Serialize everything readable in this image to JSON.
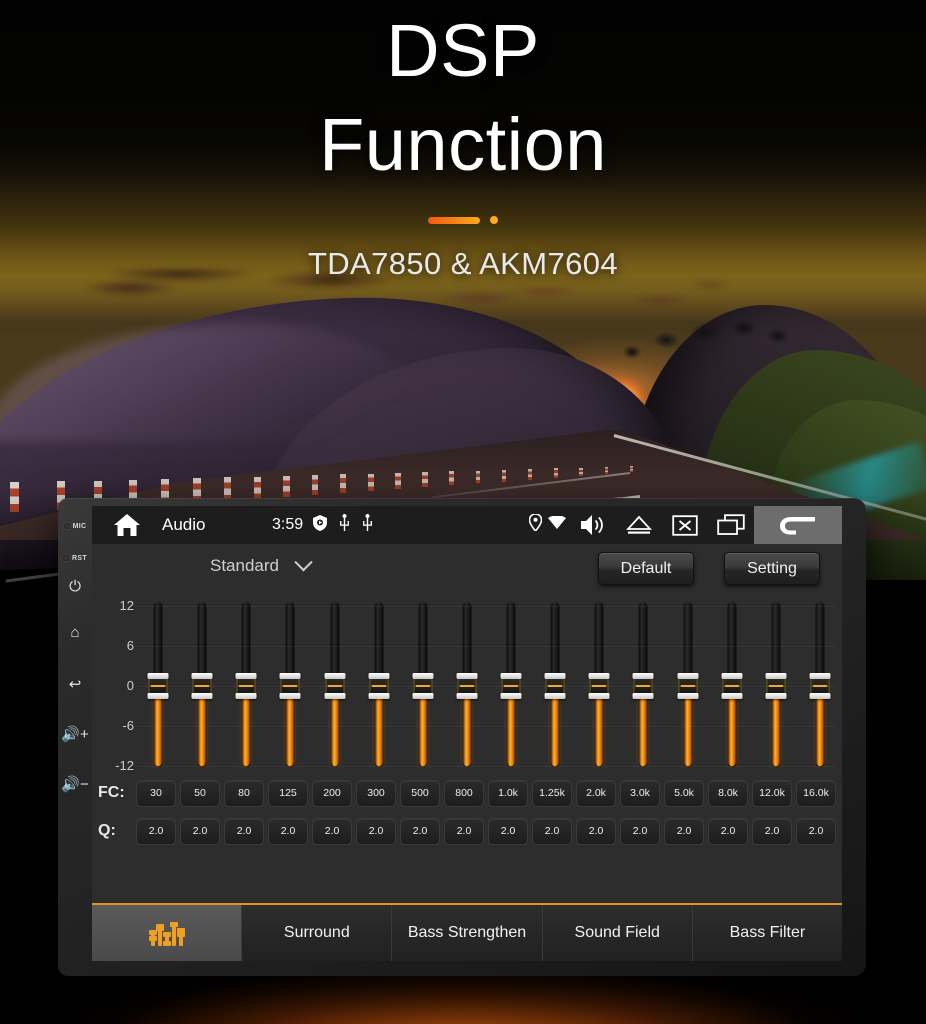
{
  "hero": {
    "title_line1": "DSP",
    "title_line2": "Function",
    "subtitle": "TDA7850 & AKM7604",
    "accent_color": "#f5821f",
    "dot_color": "#ffab1f"
  },
  "device": {
    "side_buttons": [
      {
        "name": "mic-indicator",
        "label": "MIC",
        "type": "led"
      },
      {
        "name": "reset-indicator",
        "label": "RST",
        "type": "led"
      },
      {
        "name": "power-button",
        "label": "⏻",
        "type": "icon"
      },
      {
        "name": "home-button",
        "label": "⌂",
        "type": "icon"
      },
      {
        "name": "back-button",
        "label": "↩",
        "type": "icon"
      },
      {
        "name": "volume-up-button",
        "label": "🔊+",
        "type": "icon"
      },
      {
        "name": "volume-down-button",
        "label": "🔊−",
        "type": "icon"
      }
    ]
  },
  "statusbar": {
    "home_icon": "home-icon",
    "title": "Audio",
    "time": "3:59",
    "mini_icons": [
      "shield-icon",
      "usb-icon",
      "usb-icon"
    ],
    "right_icons": [
      "location-pin-icon",
      "wifi-icon",
      "volume-icon",
      "eject-icon",
      "close-box-icon",
      "multi-window-icon"
    ],
    "back_icon": "back-arrow-icon"
  },
  "toolbar": {
    "preset": "Standard",
    "preset_chevron": "chevron-down-icon",
    "default_label": "Default",
    "setting_label": "Setting"
  },
  "equalizer": {
    "axis_labels": [
      "12",
      "6",
      "0",
      "-6",
      "-12"
    ],
    "axis_min": -12,
    "axis_max": 12,
    "fc_label": "FC:",
    "q_label": "Q:",
    "bands": [
      {
        "fc": "30",
        "q": "2.0",
        "gain": 0
      },
      {
        "fc": "50",
        "q": "2.0",
        "gain": 0
      },
      {
        "fc": "80",
        "q": "2.0",
        "gain": 0
      },
      {
        "fc": "125",
        "q": "2.0",
        "gain": 0
      },
      {
        "fc": "200",
        "q": "2.0",
        "gain": 0
      },
      {
        "fc": "300",
        "q": "2.0",
        "gain": 0
      },
      {
        "fc": "500",
        "q": "2.0",
        "gain": 0
      },
      {
        "fc": "800",
        "q": "2.0",
        "gain": 0
      },
      {
        "fc": "1.0k",
        "q": "2.0",
        "gain": 0
      },
      {
        "fc": "1.25k",
        "q": "2.0",
        "gain": 0
      },
      {
        "fc": "2.0k",
        "q": "2.0",
        "gain": 0
      },
      {
        "fc": "3.0k",
        "q": "2.0",
        "gain": 0
      },
      {
        "fc": "5.0k",
        "q": "2.0",
        "gain": 0
      },
      {
        "fc": "8.0k",
        "q": "2.0",
        "gain": 0
      },
      {
        "fc": "12.0k",
        "q": "2.0",
        "gain": 0
      },
      {
        "fc": "16.0k",
        "q": "2.0",
        "gain": 0
      }
    ],
    "slider_fill_color": "#ff8c00",
    "accent_color": "#e2941f"
  },
  "tabs": [
    {
      "name": "tab-equalizer",
      "label": "",
      "icon": "equalizer-icon",
      "active": true
    },
    {
      "name": "tab-surround",
      "label": "Surround",
      "icon": "",
      "active": false
    },
    {
      "name": "tab-bass-strengthen",
      "label": "Bass Strengthen",
      "icon": "",
      "active": false
    },
    {
      "name": "tab-sound-field",
      "label": "Sound Field",
      "icon": "",
      "active": false
    },
    {
      "name": "tab-bass-filter",
      "label": "Bass Filter",
      "icon": "",
      "active": false
    }
  ]
}
